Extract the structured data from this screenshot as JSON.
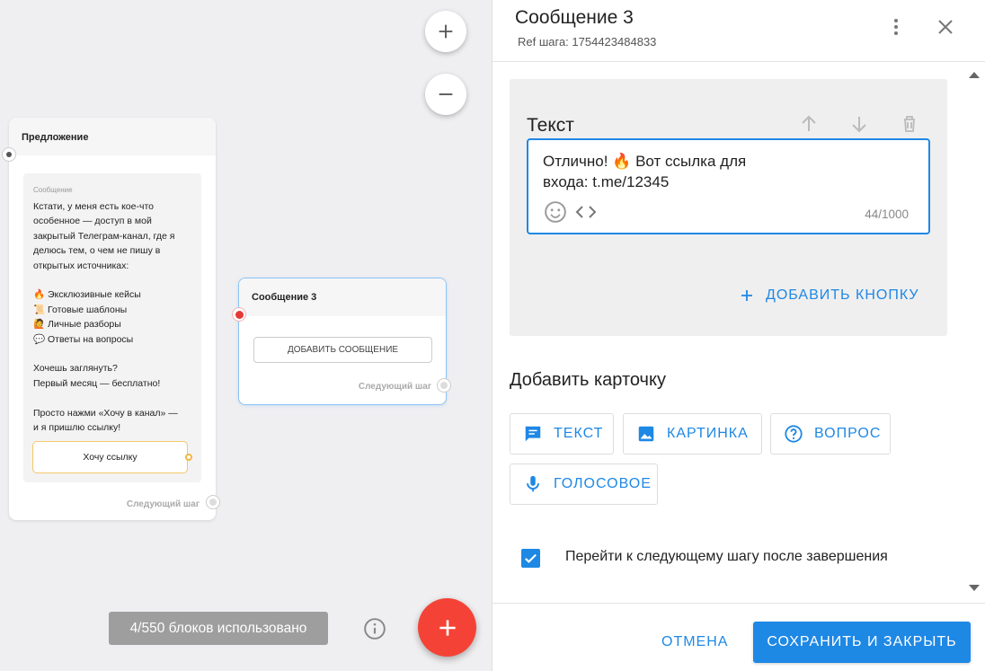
{
  "canvas": {
    "offer_node": {
      "title": "Предложение",
      "message_caption": "Сообщение",
      "message_text": "Кстати, у меня есть кое-что особенное — доступ в мой закрытый Телеграм-канал, где я делюсь тем, о чем не пишу в открытых источниках:\n\n🔥 Эксклюзивные кейсы\n📜 Готовые шаблоны\n🙋 Личные разборы\n💬 Ответы на вопросы\n\nХочешь заглянуть?\nПервый месяц — бесплатно!\n\nПросто нажми «Хочу в канал» —\nи я пришлю ссылку!",
      "button_label": "Хочу ссылку",
      "next_step_label": "Следующий шаг"
    },
    "message3_node": {
      "title": "Сообщение 3",
      "add_message_label": "ДОБАВИТЬ СООБЩЕНИЕ",
      "next_step_label": "Следующий шаг"
    },
    "blocks_used": "4/550 блоков использовано",
    "icons": [
      "zoom-in-icon",
      "zoom-out-icon",
      "info-icon",
      "add-icon"
    ]
  },
  "panel": {
    "title": "Сообщение 3",
    "ref": "Ref шага: 1754423484833",
    "text_card": {
      "title": "Текст",
      "value": "Отлично! 🔥 Вот ссылка для\nвхода: t.me/12345",
      "counter": "44/1000",
      "add_button_label": "ДОБАВИТЬ КНОПКУ"
    },
    "add_card": {
      "title": "Добавить карточку",
      "buttons": [
        {
          "label": "ТЕКСТ",
          "icon": "message-icon"
        },
        {
          "label": "КАРТИНКА",
          "icon": "image-icon"
        },
        {
          "label": "ВОПРОС",
          "icon": "question-icon"
        },
        {
          "label": "ГОЛОСОВОЕ",
          "icon": "mic-icon"
        }
      ]
    },
    "go_next_label": "Перейти к следующему шагу после завершения",
    "go_next_checked": true,
    "cancel_label": "ОТМЕНА",
    "save_label": "СОХРАНИТЬ И ЗАКРЫТЬ"
  },
  "colors": {
    "accent": "#1e88e5",
    "fab": "#f44336",
    "error_dot": "#e53935",
    "badge": "#9e9e9e"
  }
}
